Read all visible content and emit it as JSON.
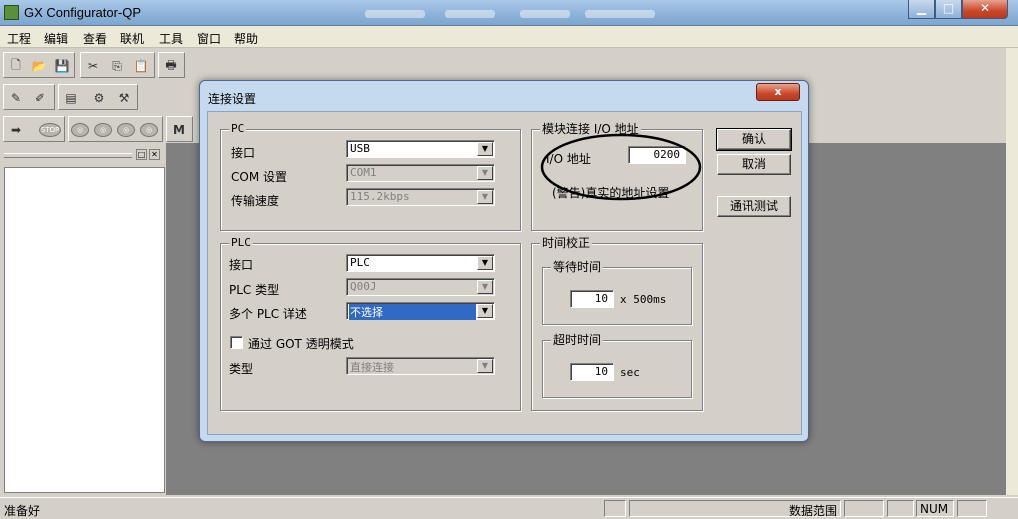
{
  "window": {
    "title": "GX Configurator-QP"
  },
  "menu": [
    "工程",
    "编辑",
    "查看",
    "联机",
    "工具",
    "窗口",
    "帮助"
  ],
  "toolbar": {
    "row1": [
      "new-icon",
      "open-icon",
      "save-icon",
      "cut-icon",
      "copy-icon",
      "paste-icon",
      "print-icon"
    ],
    "row2": [
      "tool-1-icon",
      "tool-2-icon",
      "tool-3-icon",
      "tool-4-icon",
      "tool-5-icon"
    ],
    "row3": [
      "arrow-icon",
      "stop-icon",
      "step1-icon",
      "step2-icon",
      "step3-icon",
      "step4-icon",
      "monitor-icon"
    ],
    "stop_label": "STOP",
    "monitor_label": "M"
  },
  "dialog": {
    "title": "连接设置",
    "close_label": "x",
    "pc": {
      "group_label": "PC",
      "interface_label": "接口",
      "interface_value": "USB",
      "com_label": "COM 设置",
      "com_value": "COM1",
      "speed_label": "传输速度",
      "speed_value": "115.2kbps"
    },
    "plc": {
      "group_label": "PLC",
      "interface_label": "接口",
      "interface_value": "PLC",
      "type_label": "PLC 类型",
      "type_value": "Q00J",
      "multi_label": "多个 PLC 详述",
      "multi_value": "不选择",
      "got_label": "通过 GOT 透明模式",
      "kind_label": "类型",
      "kind_value": "直接连接"
    },
    "module": {
      "group_label": "模块连接 I/O 地址",
      "io_label": "I/O 地址",
      "io_value": "0200",
      "note": "(警告)真实的地址设置"
    },
    "timing": {
      "group_label": "时间校正",
      "wait_label": "等待时间",
      "wait_value": "10",
      "wait_unit": "x 500ms",
      "timeout_label": "超时时间",
      "timeout_value": "10",
      "timeout_unit": "sec"
    },
    "buttons": {
      "ok": "确认",
      "cancel": "取消",
      "test": "通讯测试"
    }
  },
  "status": {
    "text": "准备好",
    "range_label": "数据范围",
    "num": "NUM"
  }
}
